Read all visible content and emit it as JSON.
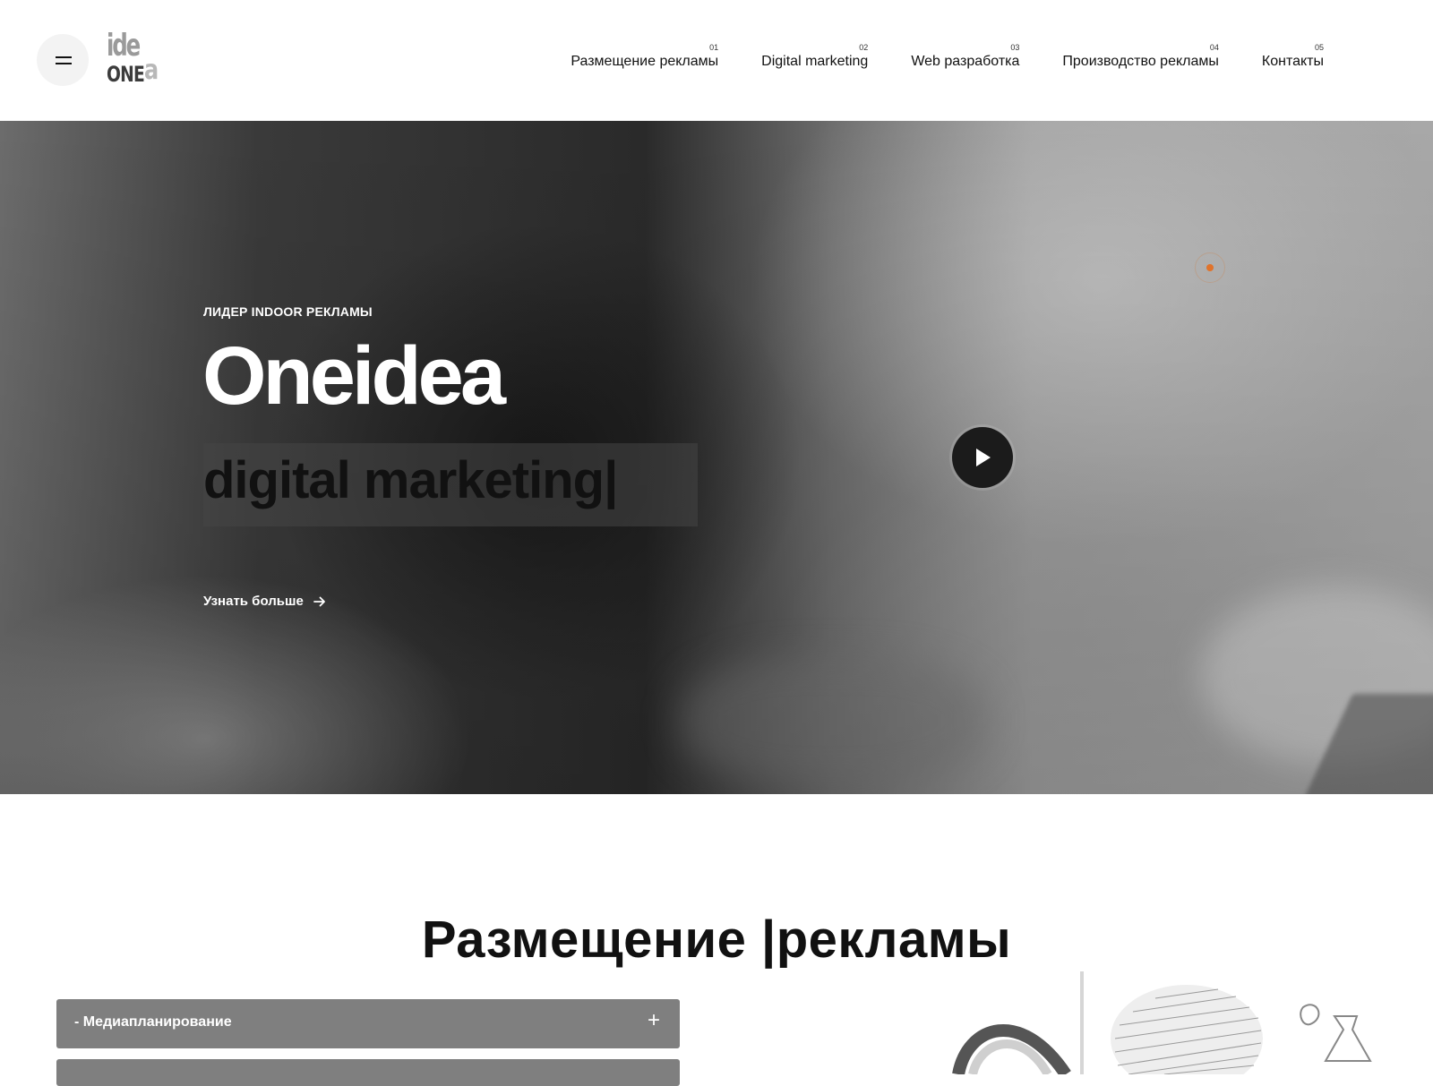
{
  "header": {
    "logo": {
      "top": "ide",
      "bottom": "ONE",
      "letter": "a"
    },
    "nav": [
      {
        "num": "01",
        "label": "Размещение рекламы"
      },
      {
        "num": "02",
        "label": "Digital marketing"
      },
      {
        "num": "03",
        "label": "Web разработка"
      },
      {
        "num": "04",
        "label": "Производство рекламы"
      },
      {
        "num": "05",
        "label": "Контакты"
      }
    ]
  },
  "hero": {
    "eyebrow": "ЛИДЕР INDOOR РЕКЛАМЫ",
    "title": "Oneidea",
    "typed": "digital marketing|",
    "more_label": "Узнать больше",
    "accent_color": "#e0732b"
  },
  "section": {
    "title": "Размещение |рекламы",
    "accordion": [
      {
        "label": "- Медиапланирование",
        "icon": "+"
      },
      {
        "label": "",
        "icon": ""
      }
    ]
  },
  "icons": [
    "menu-icon",
    "play-icon",
    "arrow-right-icon",
    "plus-icon"
  ]
}
